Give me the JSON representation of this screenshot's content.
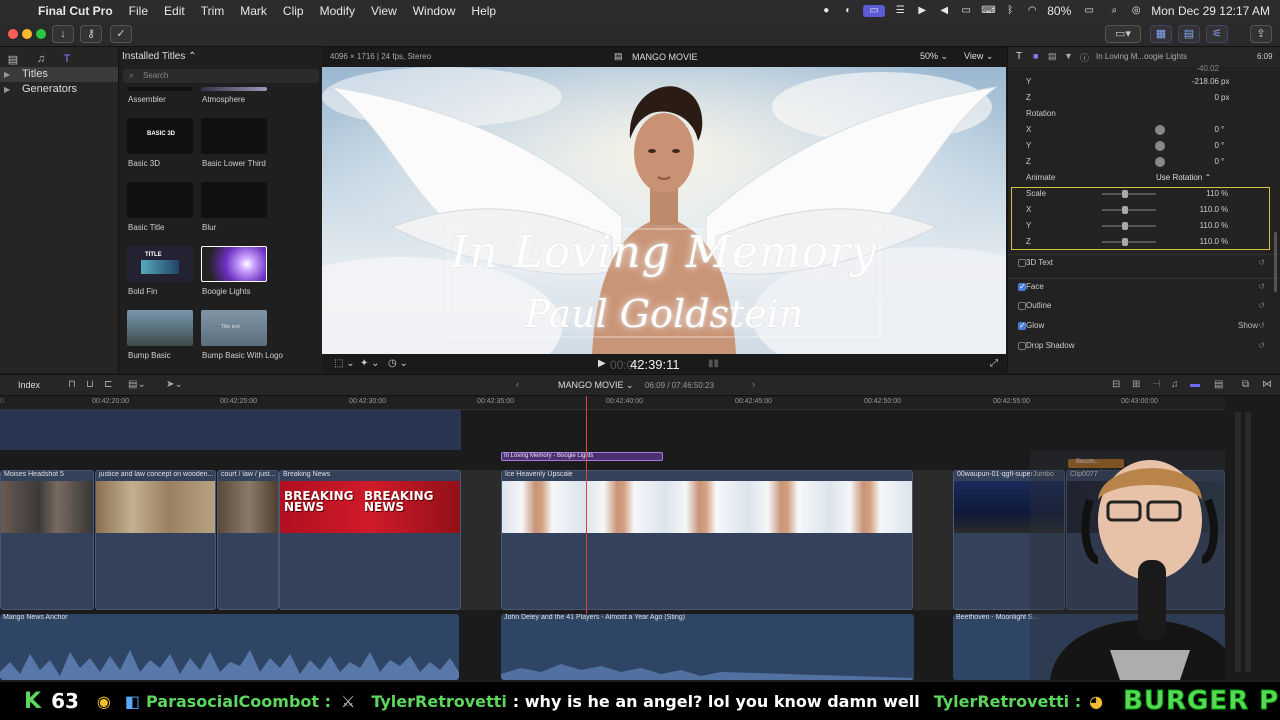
{
  "menubar": {
    "app": "Final Cut Pro",
    "items": [
      "File",
      "Edit",
      "Trim",
      "Mark",
      "Clip",
      "Modify",
      "View",
      "Window",
      "Help"
    ],
    "battery": "80%",
    "datetime": "Mon Dec 29  12:17 AM"
  },
  "library": {
    "items": [
      {
        "label": "Titles",
        "selected": true
      },
      {
        "label": "Generators",
        "selected": false
      }
    ]
  },
  "browser": {
    "header": "Installed Titles",
    "search_placeholder": "Search",
    "thumbs": [
      {
        "label": "Assembler"
      },
      {
        "label": "Atmosphere"
      },
      {
        "label": "Basic 3D",
        "text": "BASIC 3D"
      },
      {
        "label": "Basic Lower Third"
      },
      {
        "label": "Basic Title"
      },
      {
        "label": "Blur"
      },
      {
        "label": "Bold Fin",
        "text": "TITLE"
      },
      {
        "label": "Boogie Lights"
      },
      {
        "label": "Bump Basic"
      },
      {
        "label": "Bump Basic With Logo",
        "text": "Title text"
      }
    ]
  },
  "viewer": {
    "format": "4096 × 1716 | 24 fps, Stereo",
    "project": "MANGO MOVIE",
    "zoom": "50%",
    "view_label": "View",
    "title_line1": "In Loving Memory",
    "title_line2": "Paul Goldstein",
    "timecode": "42:39:11",
    "timecode_prefix": "00:00"
  },
  "inspector": {
    "clip_name": "In Loving M...oogie Lights",
    "duration": "6:09",
    "top_value": "-40.02",
    "rows": [
      {
        "label": "Y",
        "value": "-218.06",
        "unit": "px"
      },
      {
        "label": "Z",
        "value": "0",
        "unit": "px"
      }
    ],
    "rotation_label": "Rotation",
    "rotation": [
      {
        "label": "X",
        "value": "0",
        "unit": "°"
      },
      {
        "label": "Y",
        "value": "0",
        "unit": "°"
      },
      {
        "label": "Z",
        "value": "0",
        "unit": "°"
      }
    ],
    "animate_label": "Animate",
    "animate_value": "Use Rotation",
    "scale_label": "Scale",
    "scale_value": "110",
    "scale_unit": "%",
    "scale_axes": [
      {
        "label": "X",
        "value": "110.0",
        "unit": "%"
      },
      {
        "label": "Y",
        "value": "110.0",
        "unit": "%"
      },
      {
        "label": "Z",
        "value": "110.0",
        "unit": "%"
      }
    ],
    "sections": [
      {
        "label": "3D Text",
        "checked": false
      },
      {
        "label": "Face",
        "checked": true
      },
      {
        "label": "Outline",
        "checked": false
      },
      {
        "label": "Glow",
        "checked": true
      },
      {
        "label": "Drop Shadow",
        "checked": false
      }
    ],
    "glow_show": "Show"
  },
  "timeline": {
    "index_label": "Index",
    "project": "MANGO MOVIE",
    "position": "06:09 / 07:46:50:23",
    "ticks": [
      "00:42:20:00",
      "00:42:25:00",
      "00:42:30:00",
      "00:42:35:00",
      "00:42:40:00",
      "00:42:45:00",
      "00:42:50:00",
      "00:42:55:00",
      "00:43:00:00"
    ],
    "title_clip": "In Loving Memory - Boogie Lights",
    "video_clips": [
      "Moises Headshot 5",
      "justice and law concept on wooden...",
      "court / law / just...",
      "Breaking News",
      "Ice Heavenly Upscale",
      "00waupun-01-qgfl-superJumbo",
      "Clip0077",
      "Becom..."
    ],
    "breaking_text": "BREAKING NEWS",
    "audio_clips": [
      "Mango News Anchor",
      "John Deley and the 41 Players - Almost a Year Ago (Sting)",
      "Beethoven - Moonlight S..."
    ]
  },
  "ticker": {
    "count": "63",
    "user1": "ParasocialCoombot :",
    "user2": "TylerRetrovetti",
    "msg2": ": why is he an angel? lol you know damn well",
    "user3": "TylerRetrovetti :",
    "brand": "BURGER PLANET"
  },
  "colors": {
    "accent": "#4a7bdc",
    "title_clip_border": "#a67be0",
    "scale_highlight": "#d8c33a",
    "ticker_green": "#5cd65c"
  }
}
